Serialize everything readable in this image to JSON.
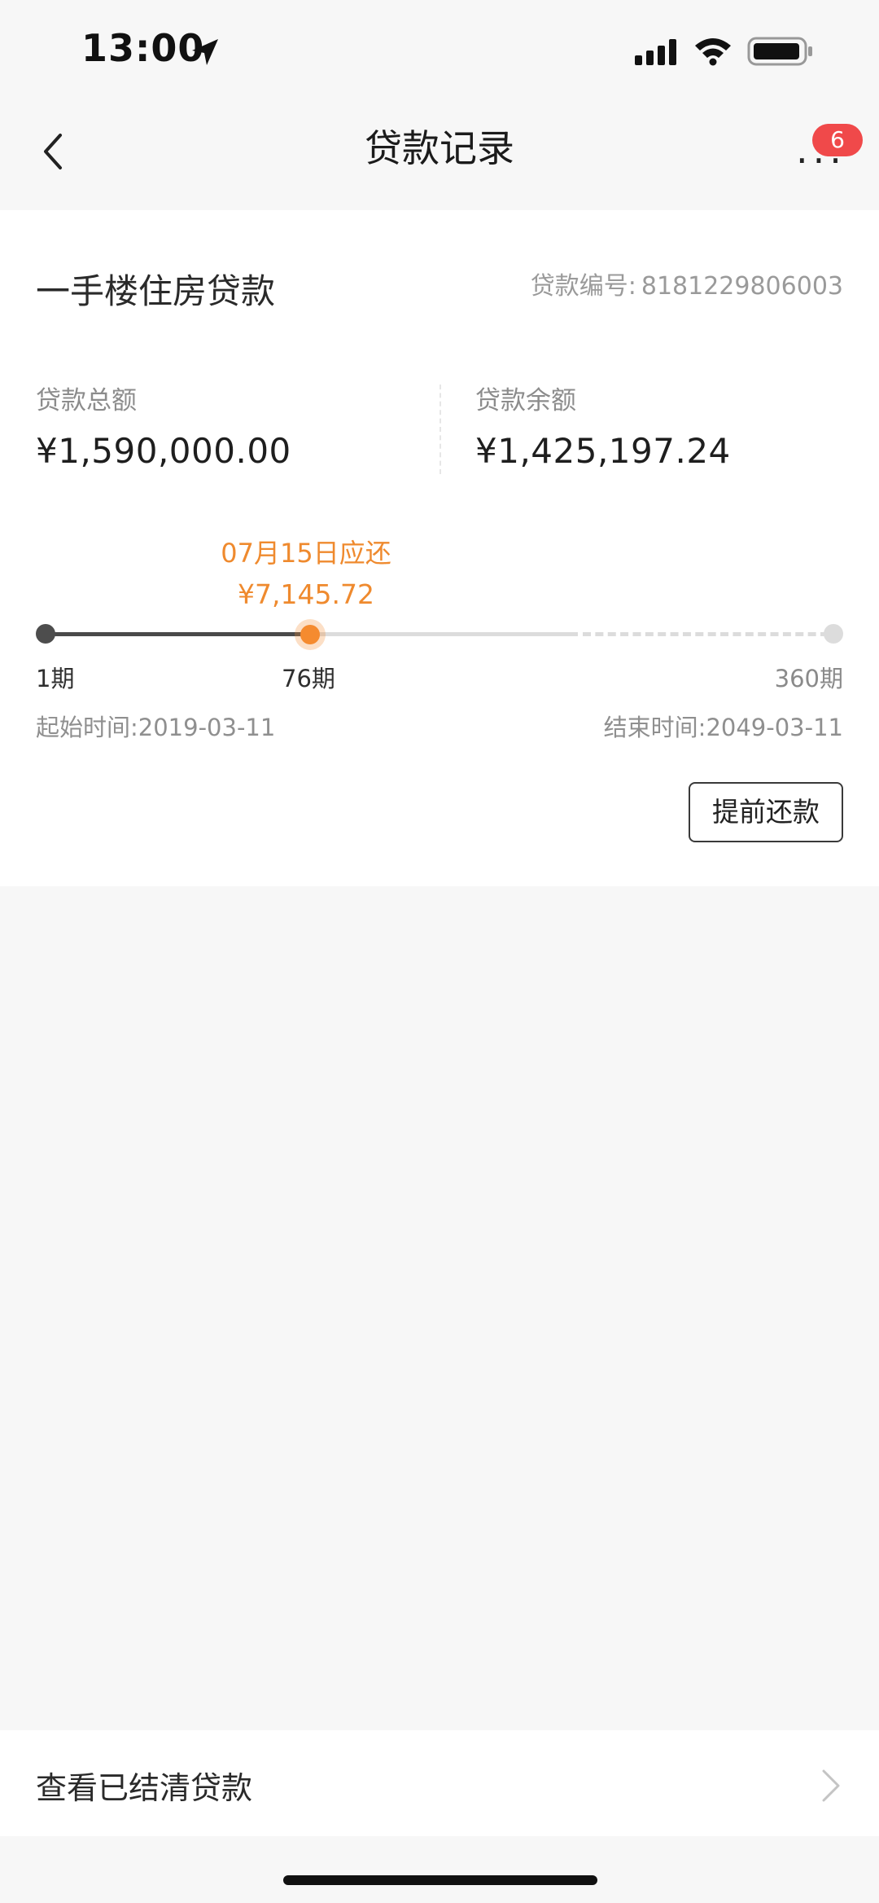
{
  "status_bar": {
    "time": "13:00"
  },
  "nav": {
    "title": "贷款记录",
    "more_badge": "6"
  },
  "loan": {
    "type": "一手楼住房贷款",
    "number_label": "贷款编号:",
    "number": "8181229806003",
    "total_label": "贷款总额",
    "total_value": "¥1,590,000.00",
    "balance_label": "贷款余额",
    "balance_value": "¥1,425,197.24",
    "due_date_text": "07月15日应还",
    "due_amount": "¥7,145.72",
    "period_start": "1期",
    "period_current": "76期",
    "period_end": "360期",
    "start_label": "起始时间:",
    "start_date": "2019-03-11",
    "end_label": "结束时间:",
    "end_date": "2049-03-11",
    "prepay_label": "提前还款"
  },
  "footer": {
    "settled_label": "查看已结清贷款"
  },
  "colors": {
    "accent": "#f58b2f",
    "badge": "#f0494a",
    "track_done": "#4a4a4a",
    "track_rest": "#dcdcdc"
  }
}
